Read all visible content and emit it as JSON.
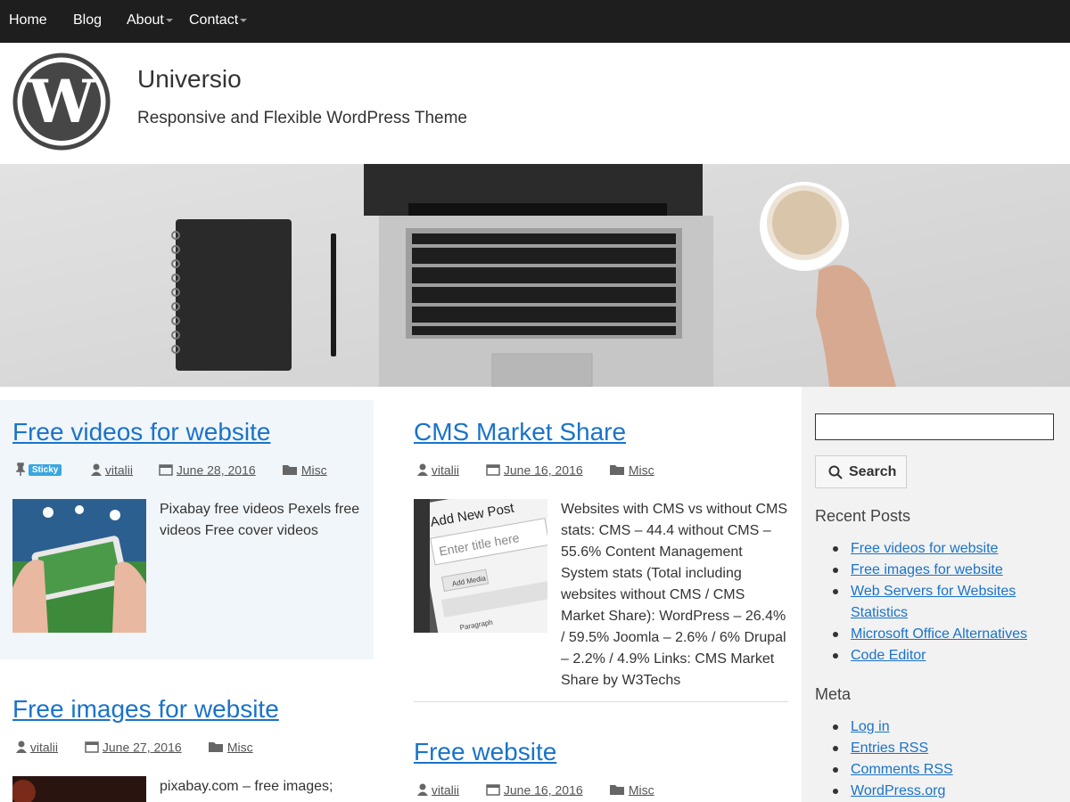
{
  "nav": {
    "items": [
      {
        "label": "Home"
      },
      {
        "label": "Blog"
      },
      {
        "label": "About"
      },
      {
        "label": "Contact"
      }
    ]
  },
  "header": {
    "title": "Universio",
    "description": "Responsive and Flexible WordPress Theme"
  },
  "posts": [
    {
      "title": "Free videos for website",
      "sticky_label": "Sticky",
      "author": "vitalii",
      "date": "June 28, 2016",
      "category": "Misc",
      "excerpt": "Pixabay free videos Pexels free videos Free cover videos"
    },
    {
      "title": "CMS Market Share",
      "author": "vitalii",
      "date": "June 16, 2016",
      "category": "Misc",
      "excerpt": "Websites with CMS vs without CMS stats: CMS – 44.4 without CMS – 55.6% Content Management System stats (Total including websites without CMS / CMS Market Share): WordPress – 26.4% / 59.5% Joomla – 2.6% / 6% Drupal – 2.2% / 4.9% Links: CMS Market Share by W3Techs",
      "thumb_text": {
        "add_new_post": "Add New Post",
        "enter_title": "Enter title here",
        "add_media": "Add Media",
        "paragraph": "Paragraph"
      }
    },
    {
      "title": "Free images for website",
      "author": "vitalii",
      "date": "June 27, 2016",
      "category": "Misc",
      "excerpt": "pixabay.com – free images;"
    },
    {
      "title": "Free website",
      "author": "vitalii",
      "date": "June 16, 2016",
      "category": "Misc"
    }
  ],
  "sidebar": {
    "search": {
      "value": "",
      "button_label": "Search"
    },
    "recent_posts": {
      "title": "Recent Posts",
      "items": [
        {
          "label": "Free videos for website"
        },
        {
          "label": "Free images for website"
        },
        {
          "label": "Web Servers for Websites Statistics"
        },
        {
          "label": "Microsoft Office Alternatives"
        },
        {
          "label": "Code Editor"
        }
      ]
    },
    "meta": {
      "title": "Meta",
      "items": [
        {
          "label": "Log in"
        },
        {
          "label": "Entries RSS"
        },
        {
          "label": "Comments RSS"
        },
        {
          "label": "WordPress.org"
        }
      ]
    }
  },
  "colors": {
    "nav_bg": "#1e1e1e",
    "link": "#1a73c9",
    "sticky_badge": "#3aa7e0",
    "sidebar_bg": "#f2f2f2",
    "sticky_post_bg": "#f1f6fa"
  },
  "icons": [
    "wordpress-logo",
    "pin-icon",
    "user-icon",
    "calendar-icon",
    "folder-icon",
    "search-icon"
  ]
}
